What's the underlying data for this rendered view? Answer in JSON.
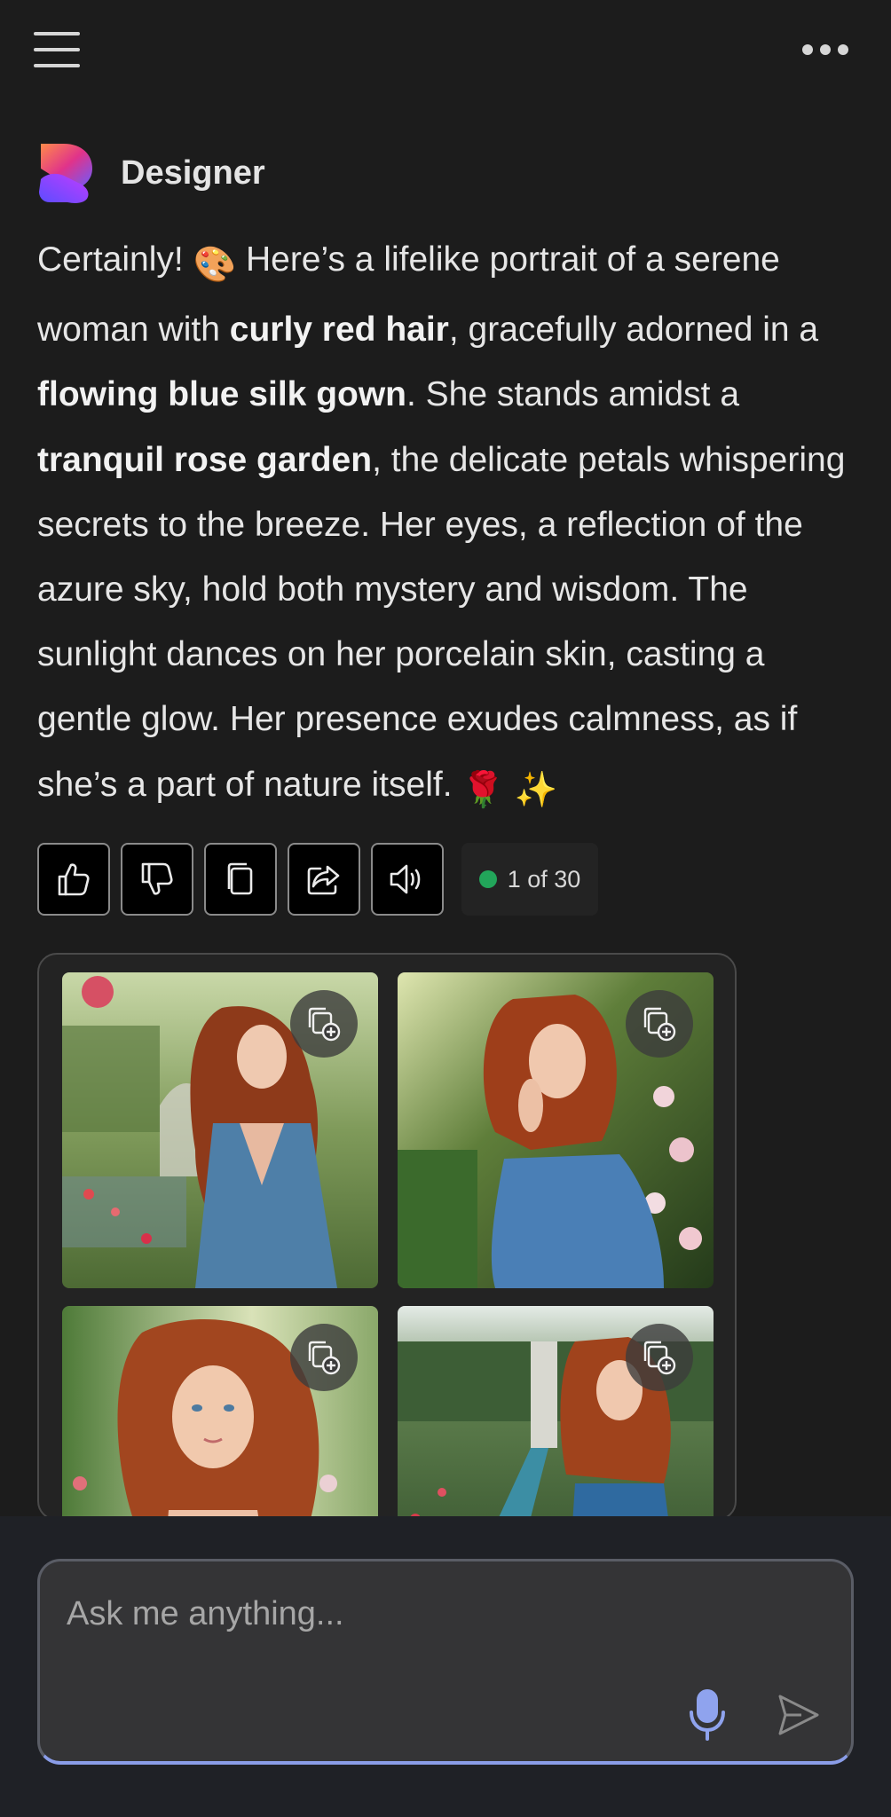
{
  "topbar": {
    "menu_icon": "hamburger-menu-icon",
    "more_icon": "more-horizontal-icon"
  },
  "assistant": {
    "name": "Designer",
    "logo_icon": "designer-logo-icon",
    "logo_colors": [
      "#ff7a59",
      "#c13cff",
      "#6a5cff"
    ]
  },
  "message": {
    "t1": "Certainly! ",
    "e_palette": "🎨",
    "t2": " Here’s a lifelike portrait of a serene woman with ",
    "b1": "curly red hair",
    "t3": ", gracefully adorned in a ",
    "b2": "flowing blue silk gown",
    "t4": ". She stands amidst a ",
    "b3": "tranquil rose garden",
    "t5": ", the delicate petals whispering secrets to the breeze. Her eyes, a reflection of the azure sky, hold both mystery and wisdom. The sunlight dances on her porcelain skin, casting a gentle glow. Her presence exudes calmness, as if she’s a part of nature itself. ",
    "e_rose": "🌹",
    "e_sparkles": "✨"
  },
  "actions": {
    "buttons": [
      "thumbs-up-icon",
      "thumbs-down-icon",
      "copy-icon",
      "share-icon",
      "read-aloud-icon"
    ],
    "counter_text": "1 of 30",
    "counter_color": "#22a55a"
  },
  "gallery": {
    "images": [
      {
        "alt": "Woman with curly red hair in blue gown in rose garden"
      },
      {
        "alt": "Woman in blue silk gown touching her face among roses"
      },
      {
        "alt": "Portrait of woman with curly red hair and blue eyes"
      },
      {
        "alt": "Woman holding a rose beside a reflecting pool"
      }
    ],
    "add_to_collection_icon": "add-to-collection-icon"
  },
  "composer": {
    "placeholder": "Ask me anything...",
    "mic_icon": "microphone-icon",
    "send_icon": "send-icon",
    "accent": "#8a9de8"
  }
}
